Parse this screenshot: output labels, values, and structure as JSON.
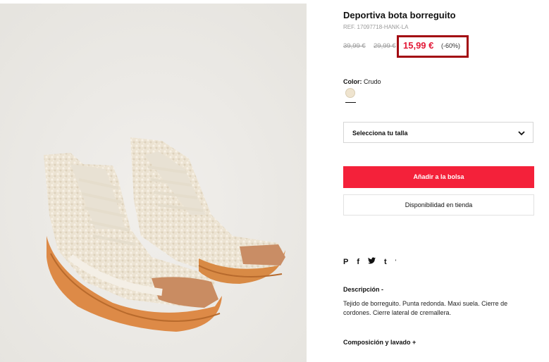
{
  "product": {
    "title": "Deportiva bota borreguito",
    "ref": "REF. 17097718-HANK-LA",
    "old_price_1": "39,99 €",
    "old_price_2": "29,99 €",
    "price": "15,99 €",
    "discount": "(-60%)"
  },
  "color": {
    "label": "Color:",
    "value": "Crudo",
    "swatch_hex": "#efe4cf"
  },
  "size_select": {
    "label": "Selecciona tu talla",
    "icon": "chevron-down-icon"
  },
  "buttons": {
    "add_to_bag": "Añadir a la bolsa",
    "store_availability": "Disponibilidad en tienda"
  },
  "share": {
    "icons": [
      "pinterest-icon",
      "facebook-icon",
      "twitter-icon",
      "tumblr-icon"
    ],
    "pinterest": "P",
    "facebook": "f",
    "twitter": "🐦",
    "tumblr": "t",
    "more": "'"
  },
  "description": {
    "heading": "Descripción -",
    "text": "Tejido de borreguito. Punta redonda. Maxi suela. Cierre de cordones. Cierre lateral de cremallera."
  },
  "composition": {
    "heading": "Composición y lavado +"
  },
  "colors": {
    "accent": "#f4213a",
    "price_red": "#e31937",
    "highlight_box": "#a30a12"
  }
}
